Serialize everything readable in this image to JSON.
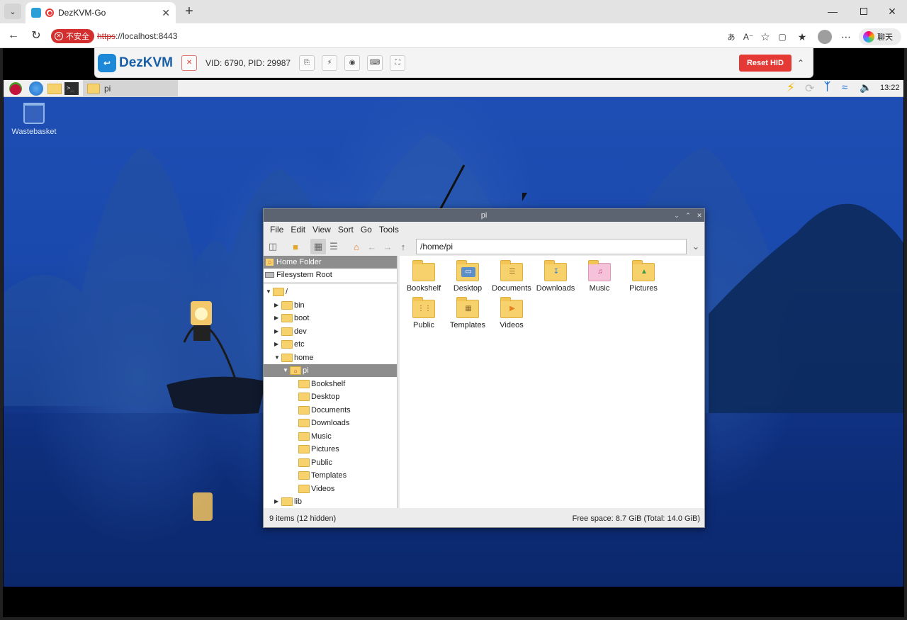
{
  "browser": {
    "tab_title": "DezKVM-Go",
    "security_label": "不安全",
    "url_scheme": "https",
    "url_rest": "://localhost:8443",
    "chat_label": "聊天"
  },
  "kvm": {
    "logo_text": "DezKVM",
    "device_ids": "VID: 6790, PID: 29987",
    "reset_label": "Reset HID",
    "accent": "#e53935"
  },
  "desktop": {
    "taskbar_window": "pi",
    "clock": "13:22",
    "wastebasket_label": "Wastebasket"
  },
  "filemanager": {
    "title": "pi",
    "menu": [
      "File",
      "Edit",
      "View",
      "Sort",
      "Go",
      "Tools"
    ],
    "path": "/home/pi",
    "places": [
      {
        "label": "Home Folder",
        "icon": "home-icon"
      },
      {
        "label": "Filesystem Root",
        "icon": "drive-icon"
      }
    ],
    "tree": {
      "root": "/",
      "dirs": [
        "bin",
        "boot",
        "dev",
        "etc",
        "home"
      ],
      "home_child": "pi",
      "pi_children": [
        "Bookshelf",
        "Desktop",
        "Documents",
        "Downloads",
        "Music",
        "Pictures",
        "Public",
        "Templates",
        "Videos"
      ],
      "after": [
        "lib"
      ]
    },
    "items": [
      {
        "label": "Bookshelf",
        "icon": "folder-icon"
      },
      {
        "label": "Desktop",
        "icon": "desktop-folder-icon"
      },
      {
        "label": "Documents",
        "icon": "documents-folder-icon"
      },
      {
        "label": "Downloads",
        "icon": "downloads-folder-icon"
      },
      {
        "label": "Music",
        "icon": "music-folder-icon"
      },
      {
        "label": "Pictures",
        "icon": "pictures-folder-icon"
      },
      {
        "label": "Public",
        "icon": "public-folder-icon"
      },
      {
        "label": "Templates",
        "icon": "templates-folder-icon"
      },
      {
        "label": "Videos",
        "icon": "videos-folder-icon"
      }
    ],
    "status_left": "9 items (12 hidden)",
    "status_right": "Free space: 8.7 GiB (Total: 14.0 GiB)"
  }
}
